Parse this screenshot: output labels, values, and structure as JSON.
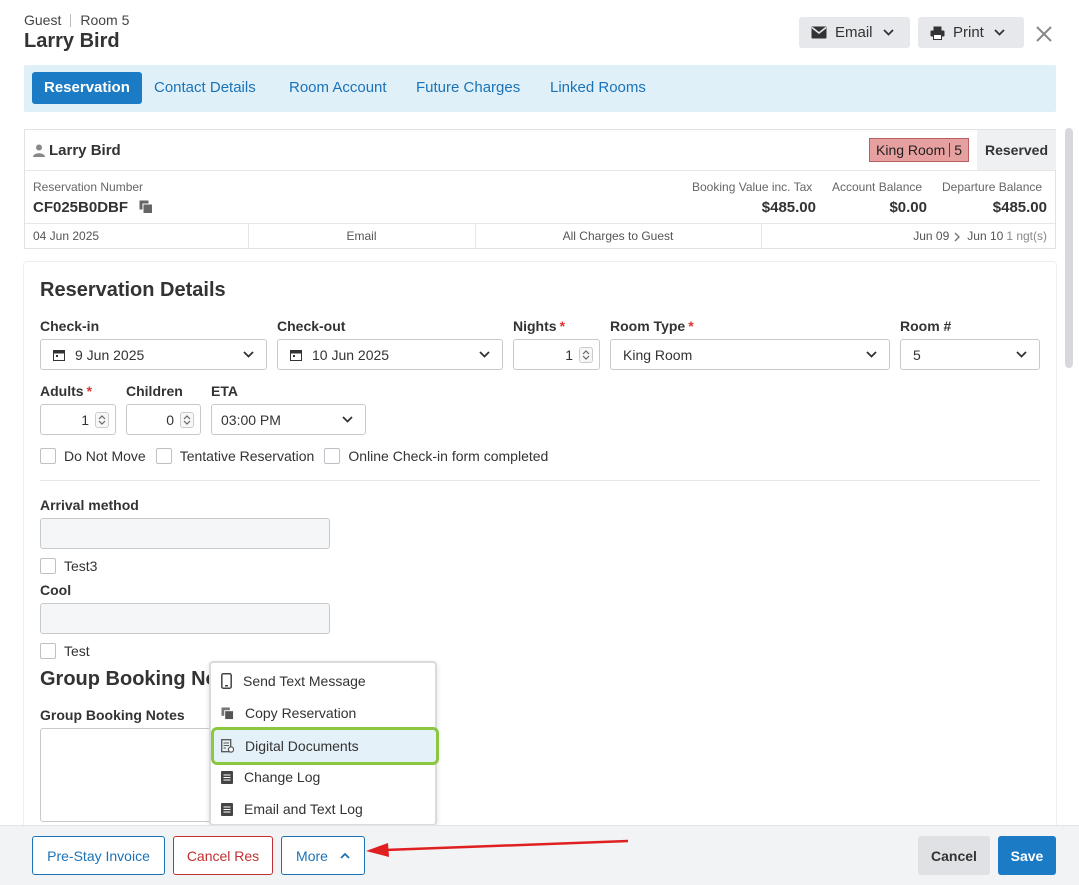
{
  "header": {
    "breadcrumb_type": "Guest",
    "breadcrumb_room": "Room 5",
    "guest_name": "Larry Bird",
    "email_label": "Email",
    "print_label": "Print"
  },
  "tabs": [
    "Reservation",
    "Contact Details",
    "Room Account",
    "Future Charges",
    "Linked Rooms"
  ],
  "summary": {
    "guest_name": "Larry Bird",
    "room_type": "King Room",
    "room_number": "5",
    "status": "Reserved",
    "reservation_number_label": "Reservation Number",
    "reservation_number": "CF025B0DBF",
    "booking_value_label": "Booking Value inc. Tax",
    "booking_value": "$485.00",
    "account_balance_label": "Account Balance",
    "account_balance": "$0.00",
    "departure_balance_label": "Departure Balance",
    "departure_balance": "$485.00",
    "created_date": "04 Jun 2025",
    "source": "Email",
    "charges": "All Charges to Guest",
    "date_from": "Jun 09",
    "date_to": "Jun 10",
    "nights_text": "1 ngt(s)"
  },
  "details": {
    "title": "Reservation Details",
    "checkin_label": "Check-in",
    "checkin_value": "9 Jun 2025",
    "checkout_label": "Check-out",
    "checkout_value": "10 Jun 2025",
    "nights_label": "Nights",
    "nights_value": "1",
    "room_type_label": "Room Type",
    "room_type_value": "King Room",
    "room_num_label": "Room #",
    "room_num_value": "5",
    "adults_label": "Adults",
    "adults_value": "1",
    "children_label": "Children",
    "children_value": "0",
    "eta_label": "ETA",
    "eta_value": "03:00 PM",
    "required_mark": "*",
    "checkboxes": [
      "Do Not Move",
      "Tentative Reservation",
      "Online Check-in form completed"
    ]
  },
  "custom_fields": {
    "arrival_label": "Arrival method",
    "arrival_value": "",
    "test3_label": "Test3",
    "cool_label": "Cool",
    "cool_value": "",
    "test_label": "Test"
  },
  "group": {
    "title": "Group Booking Notes",
    "notes_label": "Group Booking Notes"
  },
  "more_menu": [
    "Send Text Message",
    "Copy Reservation",
    "Digital Documents",
    "Change Log",
    "Email and Text Log"
  ],
  "footer": {
    "prestay_label": "Pre-Stay Invoice",
    "cancel_res_label": "Cancel Res",
    "more_label": "More",
    "cancel_label": "Cancel",
    "save_label": "Save"
  },
  "colors": {
    "primary_blue": "#1b7bc4",
    "tab_bar_bg": "#dff0f8",
    "room_badge_bg": "#e7a0a0",
    "highlight_outline": "#8bc73f",
    "annotation_arrow": "#e02020"
  },
  "icons": [
    "envelope-icon",
    "printer-icon",
    "close-icon",
    "user-icon",
    "copy-icon",
    "calendar-icon",
    "chevron-down-icon",
    "spinner-icon",
    "phone-icon",
    "document-icon",
    "log-icon",
    "chevron-up-icon"
  ]
}
